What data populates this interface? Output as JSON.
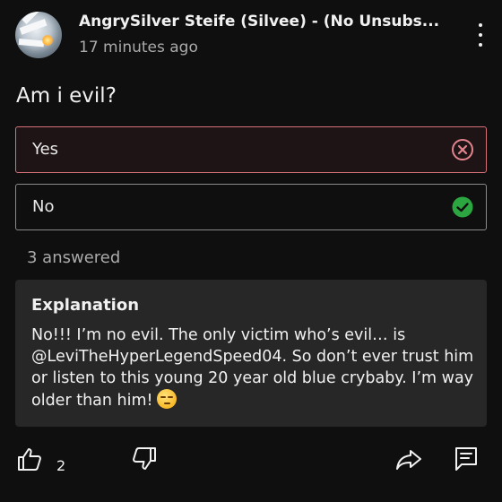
{
  "post": {
    "channel_name": "AngrySilver Steife (Silvee) - (No Unsubs...",
    "time_ago": "17 minutes ago"
  },
  "poll": {
    "question": "Am i evil?",
    "options": [
      {
        "label": "Yes",
        "state": "wrong",
        "icon": "x-circle-icon"
      },
      {
        "label": "No",
        "state": "correct",
        "icon": "check-circle-icon"
      }
    ],
    "answered_text": "3 answered"
  },
  "explanation": {
    "title": "Explanation",
    "text": "No!!! I’m no evil. The only victim who’s evil… is @LeviTheHyperLegendSpeed04. So don’t ever trust him or listen to this young 20 year old blue crybaby. I’m way older than him!",
    "emoji": "unamused-face-emoji"
  },
  "actions": {
    "like_count": "2",
    "icons": [
      "thumb-up-icon",
      "thumb-down-icon",
      "share-icon",
      "comments-icon"
    ]
  },
  "colors": {
    "background": "#0f0f0f",
    "wrong_border": "#d5707a",
    "correct_check": "#2ba640",
    "card": "#272727"
  }
}
